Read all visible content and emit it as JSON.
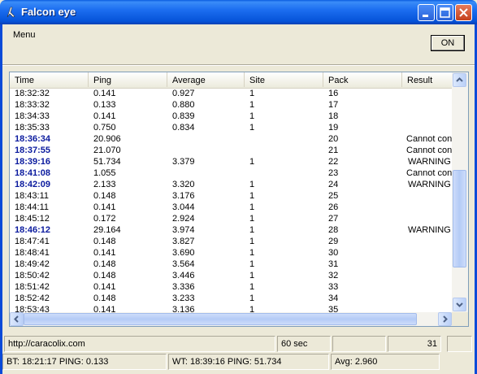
{
  "window": {
    "title": "Falcon eye"
  },
  "menu": {
    "label": "Menu"
  },
  "toggle": {
    "label": "ON"
  },
  "table": {
    "columns": [
      "Time",
      "Ping",
      "Average",
      "Site",
      "Pack",
      "Result"
    ],
    "rows": [
      {
        "time": "18:32:32",
        "ping": "0.141",
        "average": "0.927",
        "site": "1",
        "pack": "16",
        "result": "",
        "bold": false
      },
      {
        "time": "18:33:32",
        "ping": "0.133",
        "average": "0.880",
        "site": "1",
        "pack": "17",
        "result": "",
        "bold": false
      },
      {
        "time": "18:34:33",
        "ping": "0.141",
        "average": "0.839",
        "site": "1",
        "pack": "18",
        "result": "",
        "bold": false
      },
      {
        "time": "18:35:33",
        "ping": "0.750",
        "average": "0.834",
        "site": "1",
        "pack": "19",
        "result": "",
        "bold": false
      },
      {
        "time": "18:36:34",
        "ping": "20.906",
        "average": "",
        "site": "",
        "pack": "20",
        "result": "Cannot conn",
        "bold": true
      },
      {
        "time": "18:37:55",
        "ping": "21.070",
        "average": "",
        "site": "",
        "pack": "21",
        "result": "Cannot conn",
        "bold": true
      },
      {
        "time": "18:39:16",
        "ping": "51.734",
        "average": "3.379",
        "site": "1",
        "pack": "22",
        "result": "WARNING",
        "bold": true
      },
      {
        "time": "18:41:08",
        "ping": "1.055",
        "average": "",
        "site": "",
        "pack": "23",
        "result": "Cannot conn",
        "bold": true
      },
      {
        "time": "18:42:09",
        "ping": "2.133",
        "average": "3.320",
        "site": "1",
        "pack": "24",
        "result": "WARNING",
        "bold": true
      },
      {
        "time": "18:43:11",
        "ping": "0.148",
        "average": "3.176",
        "site": "1",
        "pack": "25",
        "result": "",
        "bold": false
      },
      {
        "time": "18:44:11",
        "ping": "0.141",
        "average": "3.044",
        "site": "1",
        "pack": "26",
        "result": "",
        "bold": false
      },
      {
        "time": "18:45:12",
        "ping": "0.172",
        "average": "2.924",
        "site": "1",
        "pack": "27",
        "result": "",
        "bold": false
      },
      {
        "time": "18:46:12",
        "ping": "29.164",
        "average": "3.974",
        "site": "1",
        "pack": "28",
        "result": "WARNING",
        "bold": true
      },
      {
        "time": "18:47:41",
        "ping": "0.148",
        "average": "3.827",
        "site": "1",
        "pack": "29",
        "result": "",
        "bold": false
      },
      {
        "time": "18:48:41",
        "ping": "0.141",
        "average": "3.690",
        "site": "1",
        "pack": "30",
        "result": "",
        "bold": false
      },
      {
        "time": "18:49:42",
        "ping": "0.148",
        "average": "3.564",
        "site": "1",
        "pack": "31",
        "result": "",
        "bold": false
      },
      {
        "time": "18:50:42",
        "ping": "0.148",
        "average": "3.446",
        "site": "1",
        "pack": "32",
        "result": "",
        "bold": false
      },
      {
        "time": "18:51:42",
        "ping": "0.141",
        "average": "3.336",
        "site": "1",
        "pack": "33",
        "result": "",
        "bold": false
      },
      {
        "time": "18:52:42",
        "ping": "0.148",
        "average": "3.233",
        "site": "1",
        "pack": "34",
        "result": "",
        "bold": false
      },
      {
        "time": "18:53:43",
        "ping": "0.141",
        "average": "3.136",
        "site": "1",
        "pack": "35",
        "result": "",
        "bold": false
      }
    ]
  },
  "status1": {
    "url": "http://caracolix.com",
    "interval": "60 sec",
    "blank": "",
    "count": "31"
  },
  "status2": {
    "bt": "BT: 18:21:17  PING: 0.133",
    "wt": "WT: 18:39:16  PING: 51.734",
    "avg": "Avg: 2.960"
  },
  "colors": {
    "titlebar": "#0552d8",
    "highlight_time": "#0a1a9e"
  },
  "icons": [
    "app-icon",
    "minimize-icon",
    "maximize-icon",
    "close-icon",
    "scroll-up-icon",
    "scroll-down-icon",
    "scroll-left-icon",
    "scroll-right-icon"
  ]
}
